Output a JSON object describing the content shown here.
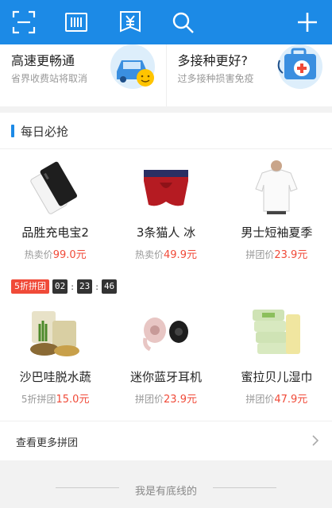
{
  "topbar": {
    "icons": [
      "scan-icon",
      "barcode-icon",
      "yen-receipt-icon",
      "search-icon",
      "plus-icon"
    ],
    "color": "#1c8ae6"
  },
  "banners": [
    {
      "title": "高速更畅通",
      "subtitle": "省界收费站将取消",
      "icon": "car-smiley-icon"
    },
    {
      "title": "多接种更好?",
      "subtitle": "过多接种损害免疫",
      "icon": "medical-kit-icon"
    }
  ],
  "daily": {
    "title": "每日必抢",
    "row1": [
      {
        "name": "品胜充电宝2",
        "price_label": "热卖价",
        "price": "99.0元",
        "icon": "power-bank-icon"
      },
      {
        "name": "3条猫人 冰",
        "price_label": "热卖价",
        "price": "49.9元",
        "icon": "underwear-icon"
      },
      {
        "name": "男士短袖夏季",
        "price_label": "拼团价",
        "price": "23.9元",
        "icon": "tshirt-icon"
      }
    ],
    "promo": {
      "badge": "5折拼团",
      "hours": "02",
      "minutes": "23",
      "seconds": "46"
    },
    "row2": [
      {
        "name": "沙巴哇脱水蔬",
        "price_label": "5折拼团",
        "price": "15.0元",
        "icon": "dried-veg-icon"
      },
      {
        "name": "迷你蓝牙耳机",
        "price_label": "拼团价",
        "price": "23.9元",
        "icon": "earbud-icon"
      },
      {
        "name": "蜜拉贝儿湿巾",
        "price_label": "拼团价",
        "price": "47.9元",
        "icon": "wet-wipes-icon"
      }
    ],
    "more": "查看更多拼团"
  },
  "footer": {
    "text": "我是有底线的"
  }
}
